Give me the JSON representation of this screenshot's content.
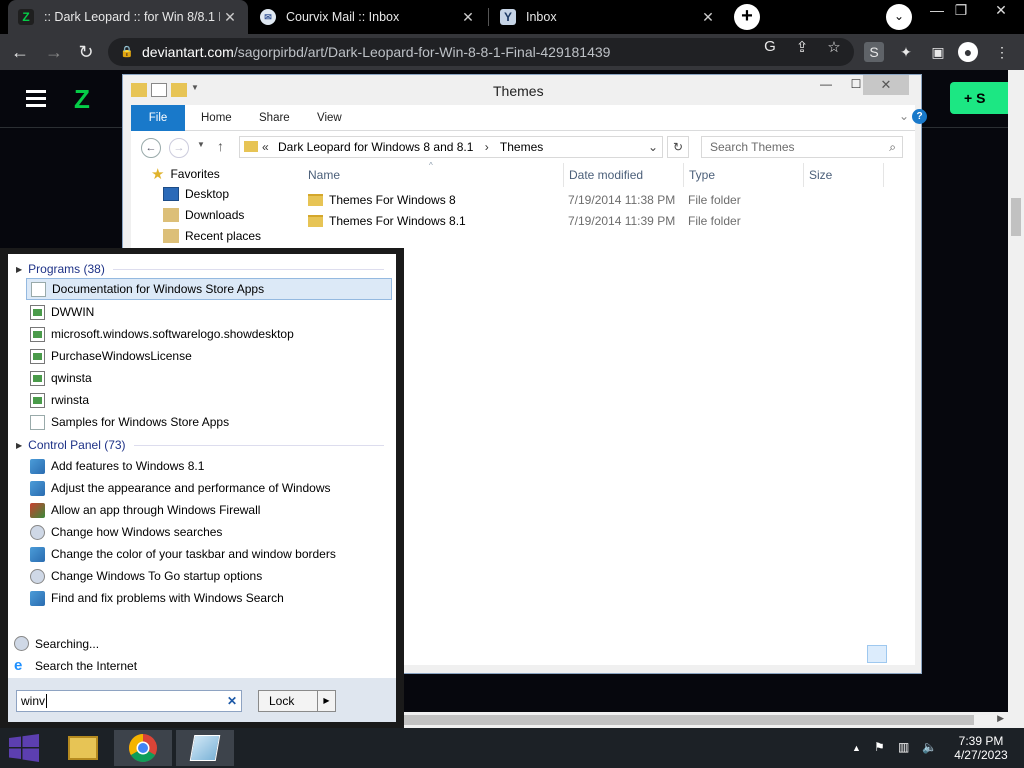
{
  "browser": {
    "tabs": [
      {
        "title": ":: Dark Leopard :: for Win 8/8.1 Fi",
        "favicon": "deviantart-icon"
      },
      {
        "title": "Courvix Mail :: Inbox",
        "favicon": "mail-icon"
      },
      {
        "title": "Inbox",
        "favicon": "y-icon"
      }
    ],
    "url_host": "deviantart.com",
    "url_path": "/sagorpirbd/art/Dark-Leopard-for-Win-8-8-1-Final-429181439"
  },
  "page": {
    "submit_label": "S"
  },
  "explorer": {
    "title": "Themes",
    "ribbon_tabs": [
      "File",
      "Home",
      "Share",
      "View"
    ],
    "breadcrumb_prefix": "«",
    "breadcrumb": [
      "Dark Leopard for Windows 8 and 8.1",
      "Themes"
    ],
    "search_placeholder": "Search Themes",
    "nav": {
      "favorites": "Favorites",
      "desktop": "Desktop",
      "downloads": "Downloads",
      "recent": "Recent places"
    },
    "columns": {
      "name": "Name",
      "date": "Date modified",
      "type": "Type",
      "size": "Size"
    },
    "files": [
      {
        "name": "Themes For Windows 8",
        "date": "7/19/2014 11:38 PM",
        "type": "File folder"
      },
      {
        "name": "Themes For Windows 8.1",
        "date": "7/19/2014 11:39 PM",
        "type": "File folder"
      }
    ]
  },
  "start": {
    "programs_header": "Programs (38)",
    "programs": [
      "Documentation for Windows Store Apps",
      "DWWIN",
      "microsoft.windows.softwarelogo.showdesktop",
      "PurchaseWindowsLicense",
      "qwinsta",
      "rwinsta",
      "Samples for Windows Store Apps"
    ],
    "control_header": "Control Panel (73)",
    "control": [
      "Add features to Windows 8.1",
      "Adjust the appearance and performance of Windows",
      "Allow an app through Windows Firewall",
      "Change how Windows searches",
      "Change the color of your taskbar and window borders",
      "Change Windows To Go startup options",
      "Find and fix problems with Windows Search"
    ],
    "searching": "Searching...",
    "search_internet": "Search the Internet",
    "query": "winv",
    "lock_label": "Lock"
  },
  "taskbar": {
    "time": "7:39 PM",
    "date": "4/27/2023"
  }
}
